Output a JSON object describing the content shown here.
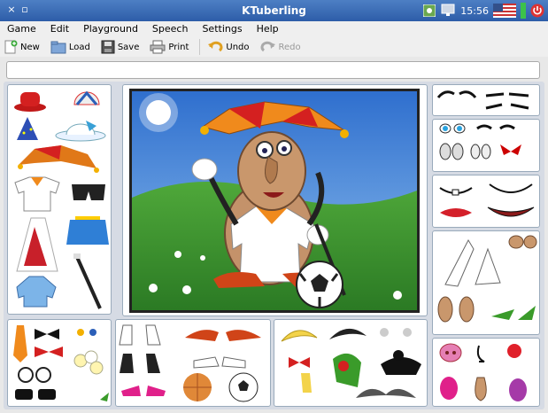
{
  "window": {
    "title": "KTuberling",
    "clock": "15:56",
    "close_glyph": "×",
    "restore_glyph": "▫"
  },
  "menu": [
    {
      "label": "Game",
      "key": "G"
    },
    {
      "label": "Edit",
      "key": "E"
    },
    {
      "label": "Playground",
      "key": "P"
    },
    {
      "label": "Speech",
      "key": "S"
    },
    {
      "label": "Settings",
      "key": "S"
    },
    {
      "label": "Help",
      "key": "H"
    }
  ],
  "toolbar": {
    "new_label": "New",
    "load_label": "Load",
    "save_label": "Save",
    "print_label": "Print",
    "undo_label": "Undo",
    "redo_label": "Redo"
  },
  "status": {
    "message": ""
  },
  "colors": {
    "titlebar": "#2d5da8",
    "sky": "#3a7bd5",
    "grass": "#3b8f2e",
    "jester_orange": "#f08a1c",
    "jester_red": "#d2281e"
  },
  "panels": {
    "hats": [
      "red-fedora",
      "beach-cap",
      "wizard-hat",
      "bonnet",
      "jester-hat",
      "shirt",
      "trunks",
      "skirt-red",
      "skirt-blue",
      "jacket",
      "cane"
    ],
    "accessories": [
      "tie",
      "bowtie-black",
      "earrings",
      "bowtie-red",
      "glasses",
      "bouquet",
      "sunglasses",
      "leaf"
    ],
    "shoes": [
      "white-boots",
      "jester-shoes",
      "black-boots",
      "sneakers",
      "pink-heels",
      "ball-orange",
      "football"
    ],
    "hair": [
      "blond-hair",
      "black-hair",
      "bow",
      "crab",
      "green-hair",
      "black-hair-bun",
      "mustache",
      "banana"
    ],
    "eyebrows": [
      "brows-1",
      "brows-2",
      "brows-3"
    ],
    "eyes": [
      "eyes-1",
      "eyes-2",
      "eyes-3",
      "eyes-4",
      "eyes-5"
    ],
    "mouths": [
      "mouth-tooth",
      "mouth-smile",
      "mouth-lips",
      "mouth-grin"
    ],
    "ears": [
      "ear-1",
      "ear-2",
      "ear-3",
      "ear-4"
    ],
    "noses": [
      "nose-pig",
      "nose-hook",
      "nose-red",
      "nose-pink",
      "nose-big",
      "nose-purple"
    ]
  }
}
